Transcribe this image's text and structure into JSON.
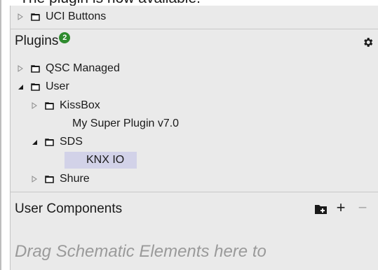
{
  "caption": "The plugin is now available:",
  "tree_top": {
    "items": [
      {
        "label": "UCI Buttons"
      }
    ]
  },
  "plugins": {
    "title": "Plugins",
    "badge_count": "2",
    "items": [
      {
        "label": "QSC Managed",
        "state": "collapsed"
      },
      {
        "label": "User",
        "state": "expanded"
      },
      {
        "label": "KissBox",
        "state": "collapsed"
      },
      {
        "label": "My Super Plugin v7.0"
      },
      {
        "label": "SDS",
        "state": "expanded"
      },
      {
        "label": "KNX IO",
        "selected": true
      },
      {
        "label": "Shure",
        "state": "collapsed"
      }
    ]
  },
  "user_components": {
    "title": "User Components",
    "add_label": "+",
    "remove_label": "−",
    "placeholder": "Drag Schematic Elements here to"
  },
  "colors": {
    "panel_bg": "#eaeaea",
    "selection": "#d2d2e8",
    "badge": "#2e8b2e",
    "hint_text": "#9a9a9a"
  },
  "icons": [
    "folder-icon",
    "expand-arrow-icon",
    "collapse-arrow-icon",
    "gear-icon",
    "new-folder-icon"
  ]
}
